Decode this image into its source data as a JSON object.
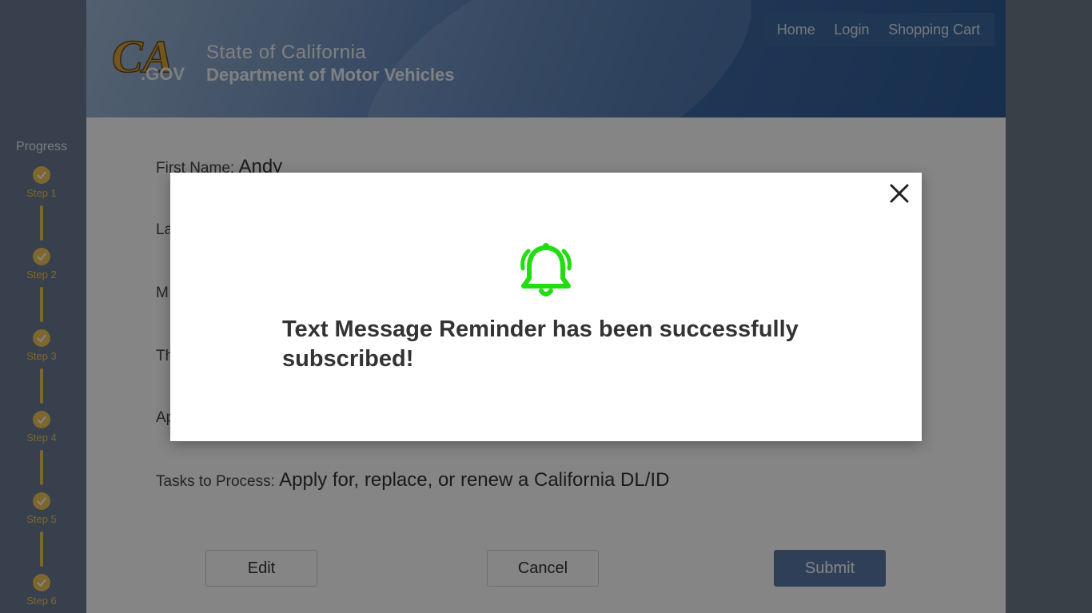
{
  "header": {
    "logo_text": "CA.GOV",
    "agency_line1": "State of California",
    "agency_line2": "Department of Motor Vehicles",
    "nav": [
      {
        "label": "Home"
      },
      {
        "label": "Login"
      },
      {
        "label": "Shopping Cart"
      }
    ]
  },
  "sidebar": {
    "title": "Progress",
    "steps": [
      {
        "label": "Step 1",
        "status": "complete"
      },
      {
        "label": "Step 2",
        "status": "complete"
      },
      {
        "label": "Step 3",
        "status": "complete"
      },
      {
        "label": "Step 4",
        "status": "complete"
      },
      {
        "label": "Step 5",
        "status": "complete"
      },
      {
        "label": "Step 6",
        "status": "complete"
      }
    ]
  },
  "form": {
    "first_name_label": "First Name:",
    "first_name_value": "Andy",
    "row2_label_partial": "La",
    "row3_label_partial": "M",
    "row4_label_partial": "Th",
    "row5_label_partial": "Ap",
    "tasks_label": "Tasks to Process:",
    "tasks_value": "Apply for, replace, or renew a California DL/ID"
  },
  "buttons": {
    "edit": "Edit",
    "cancel": "Cancel",
    "submit": "Submit"
  },
  "modal": {
    "icon": "bell-icon",
    "message": "Text Message Reminder has been successfully subscribed!",
    "icon_color": "#22dd11"
  },
  "colors": {
    "step_accent": "#f2c35a",
    "submit_bg": "#5b7aa8"
  }
}
